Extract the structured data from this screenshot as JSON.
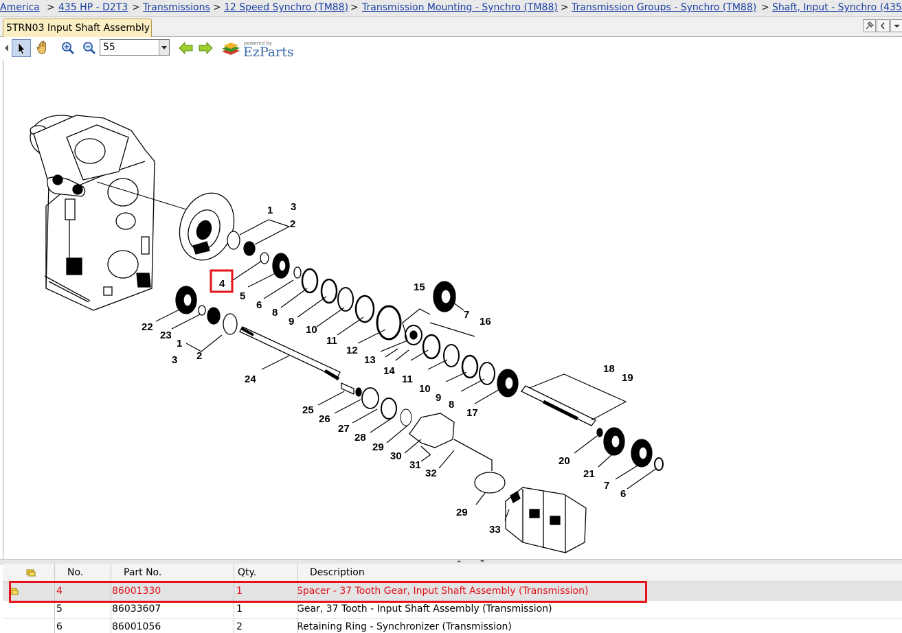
{
  "breadcrumb": [
    " America",
    "435 HP - D2T3",
    "Transmissions",
    "12 Speed Synchro (TM88)",
    "Transmission Mounting - Synchro (TM88)",
    "Transmission Groups - Synchro (TM88)",
    "Shaft, Input - Synchro (435"
  ],
  "breadcrumb_sep": ">",
  "tab": {
    "label": "5TRN03 Input Shaft Assembly"
  },
  "toolbar": {
    "zoom_value": "55",
    "logo_small": "powered by",
    "logo_text": "EzParts"
  },
  "diagram": {
    "selected_callout": "4",
    "callouts": [
      "1",
      "3",
      "2",
      "4",
      "5",
      "6",
      "8",
      "9",
      "10",
      "11",
      "12",
      "13",
      "14",
      "15",
      "16",
      "7",
      "22",
      "23",
      "1",
      "3",
      "2",
      "24",
      "11",
      "10",
      "9",
      "8",
      "17",
      "18",
      "19",
      "25",
      "26",
      "27",
      "28",
      "29",
      "30",
      "31",
      "32",
      "20",
      "21",
      "7",
      "6",
      "29",
      "33"
    ]
  },
  "table": {
    "headers": {
      "no": "No.",
      "part": "Part No.",
      "qty": "Qty.",
      "desc": "Description"
    },
    "rows": [
      {
        "no": "4",
        "part": "86001330",
        "qty": "1",
        "desc": "Spacer - 37 Tooth Gear, Input Shaft Assembly (Transmission)",
        "selected": true
      },
      {
        "no": "5",
        "part": "86033607",
        "qty": "1",
        "desc": "Gear, 37 Tooth - Input Shaft Assembly (Transmission)",
        "selected": false
      },
      {
        "no": "6",
        "part": "86001056",
        "qty": "2",
        "desc": "Retaining Ring - Synchronizer (Transmission)",
        "selected": false
      }
    ]
  },
  "colors": {
    "link": "#1a3fa3",
    "highlight": "#e3121b",
    "tab_bg": "#fbeec2"
  }
}
